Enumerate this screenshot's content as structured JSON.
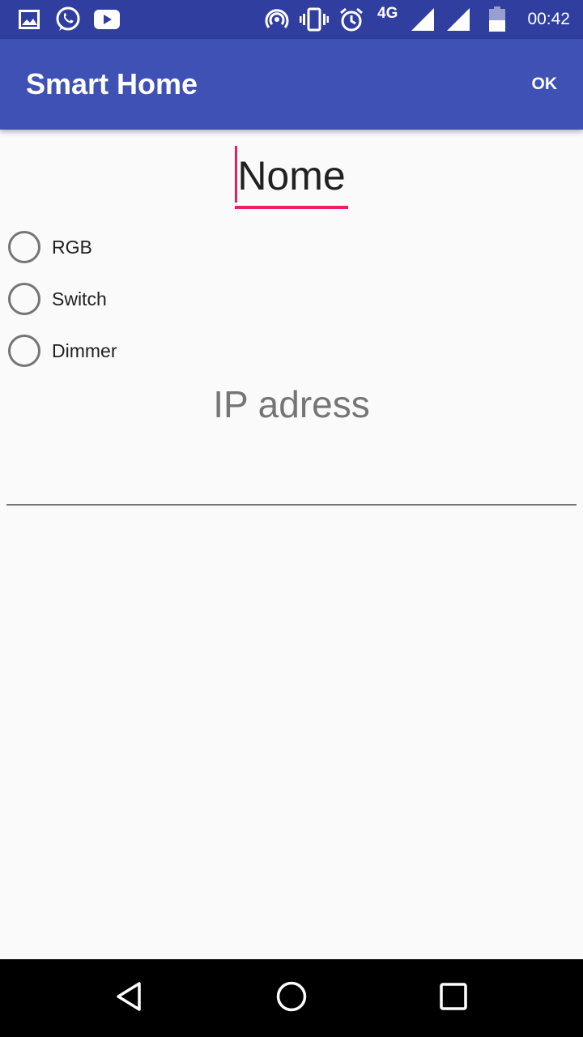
{
  "status_bar": {
    "time": "00:42",
    "network": "4G",
    "icons": [
      "gallery-icon",
      "whatsapp-icon",
      "youtube-icon",
      "hotspot-icon",
      "vibrate-icon",
      "alarm-icon",
      "signal-icon",
      "signal-icon",
      "battery-icon"
    ]
  },
  "app_bar": {
    "title": "Smart Home",
    "ok_label": "OK"
  },
  "form": {
    "name_value": "Nome",
    "options": [
      {
        "label": "RGB",
        "selected": false
      },
      {
        "label": "Switch",
        "selected": false
      },
      {
        "label": "Dimmer",
        "selected": false
      }
    ],
    "ip_placeholder": "IP adress"
  },
  "nav_bar": {
    "buttons": [
      "back-icon",
      "home-icon",
      "recents-icon"
    ]
  },
  "colors": {
    "status_bar": "#303f9f",
    "app_bar": "#3f51b5",
    "accent": "#e91e63",
    "background": "#fafafa"
  }
}
